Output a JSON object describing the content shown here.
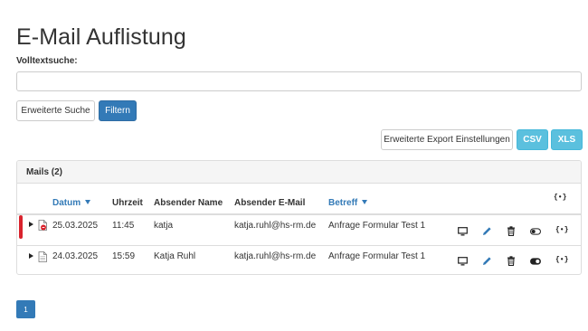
{
  "page": {
    "title": "E-Mail Auflistung"
  },
  "search": {
    "label": "Volltextsuche:",
    "value": "",
    "placeholder": ""
  },
  "buttons": {
    "advanced_search": "Erweiterte Suche",
    "filter": "Filtern",
    "export_settings": "Erweiterte Export Einstellungen",
    "csv": "CSV",
    "xls": "XLS"
  },
  "panel": {
    "heading": "Mails (2)"
  },
  "table": {
    "columns": [
      "Datum",
      "Uhrzeit",
      "Absender Name",
      "Absender E-Mail",
      "Betreff"
    ],
    "json_header": "{•}",
    "rows": [
      {
        "date": "25.03.2025",
        "time": "11:45",
        "name": "katja",
        "email": "katja.ruhl@hs-rm.de",
        "subject": "Anfrage Formular Test 1",
        "unread": true,
        "toggle": "off"
      },
      {
        "date": "24.03.2025",
        "time": "15:59",
        "name": "Katja Ruhl",
        "email": "katja.ruhl@hs-rm.de",
        "subject": "Anfrage Formular Test 1",
        "unread": false,
        "toggle": "on"
      }
    ],
    "row_json": "{•}"
  },
  "pagination": {
    "current": "1"
  },
  "colors": {
    "primary": "#337ab7",
    "info": "#5bc0de",
    "marker": "#d9232d"
  }
}
